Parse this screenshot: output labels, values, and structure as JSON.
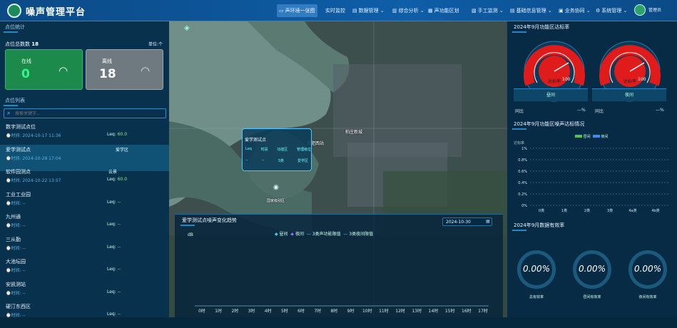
{
  "header": {
    "title": "噪声管理平台",
    "nav": [
      {
        "label": "声环境一张图",
        "icon": "monitor-icon"
      },
      {
        "label": "实时监控"
      },
      {
        "label": "数据管理",
        "icon": "data-icon"
      },
      {
        "label": "综合分析",
        "icon": "analysis-icon"
      },
      {
        "label": "声功能区划",
        "icon": "zone-icon"
      },
      {
        "label": "手工监测",
        "icon": "manual-icon"
      },
      {
        "label": "基础信息管理",
        "icon": "info-icon"
      },
      {
        "label": "业务协同",
        "icon": "cooperate-icon"
      },
      {
        "label": "系统管理",
        "icon": "gear-icon"
      }
    ],
    "user": "管理员"
  },
  "left": {
    "stats_title": "点位统计",
    "total_label": "点位总数数",
    "total_value": "18",
    "unit_label": "单位:个",
    "online_label": "在线",
    "online_value": "0",
    "offline_label": "离线",
    "offline_value": "18",
    "list_title": "点位列表",
    "search_placeholder": "搜索关键字...",
    "points": [
      {
        "name": "数字测试点位",
        "time": "2024-10-17 11:36",
        "tag": "Leq:",
        "value": "60.0"
      },
      {
        "name": "爱学测试点",
        "time": "2024-10-28 17:04",
        "tag": "爱学区",
        "value": ""
      },
      {
        "name": "软件园测点",
        "time": "2024-10-22 13:57",
        "tag": "Leq:",
        "value": "60.0",
        "tag2": "云景"
      },
      {
        "name": "工业工业园",
        "time": "--",
        "tag": "Leq:",
        "value": "--"
      },
      {
        "name": "九州通",
        "time": "--",
        "tag": "Leq:",
        "value": "--"
      },
      {
        "name": "三从勤",
        "time": "--",
        "tag": "Leq:",
        "value": "--"
      },
      {
        "name": "大池坛园",
        "time": "--",
        "tag": "Leq:",
        "value": "--"
      },
      {
        "name": "安凯测站",
        "time": "--",
        "tag": "Leq:",
        "value": "--"
      },
      {
        "name": "硬汀东西区",
        "time": "--",
        "tag": "Leq:",
        "value": "--"
      }
    ]
  },
  "map": {
    "popup_title": "爱学测试点",
    "popup_headers": [
      "Leq",
      "时段",
      "功能区",
      "管理级位"
    ],
    "popup_values": [
      "--",
      "--",
      "3类",
      "爱学区"
    ],
    "labels": [
      "合肥西站",
      "柏庄新城",
      "国家级别区"
    ]
  },
  "chart_data": {
    "type": "line",
    "title": "爱学测试点噪声变化趋势",
    "date": "2024-10-30",
    "ylabel": "dB",
    "legend": [
      "昼间",
      "夜间",
      "3类声功能限值",
      "3类夜间限值"
    ],
    "categories": [
      "0时",
      "1时",
      "2时",
      "3时",
      "4时",
      "5时",
      "6时",
      "7时",
      "8时",
      "9时",
      "10时",
      "11时",
      "12时",
      "13时",
      "14时",
      "15时",
      "16时",
      "17时"
    ],
    "series": []
  },
  "right": {
    "gauge_title": "2024年9月功能区达标率",
    "gauge_value_label": "达标率",
    "gauge_value": "100",
    "tabs": [
      "昼间",
      "夜间"
    ],
    "stat_left_label": "同比",
    "stat_left_value": "—%",
    "stat_right_label": "同比",
    "stat_right_value": "—%",
    "bar_title": "2024年9月功能区噪声达标情况",
    "bar_legend": [
      "昼间",
      "夜间"
    ],
    "bar_ylabel": "达标率",
    "bar_y_ticks": [
      "1%",
      "0.8%",
      "0.6%",
      "0.4%",
      "0.2%",
      "0%"
    ],
    "bar_categories": [
      "0类",
      "1类",
      "2类",
      "3类",
      "4a类",
      "4b类"
    ],
    "ring_title": "2024年9月数据有效率",
    "rings": [
      {
        "value": "0.00%",
        "label": "总有效率"
      },
      {
        "value": "0.00%",
        "label": "昼间有效率"
      },
      {
        "value": "0.00%",
        "label": "夜间有效率"
      }
    ]
  },
  "colors": {
    "online": "#1c8a4a",
    "offline": "#6f7a80",
    "gauge": "#e01b1b",
    "accent": "#1d8ac7"
  }
}
